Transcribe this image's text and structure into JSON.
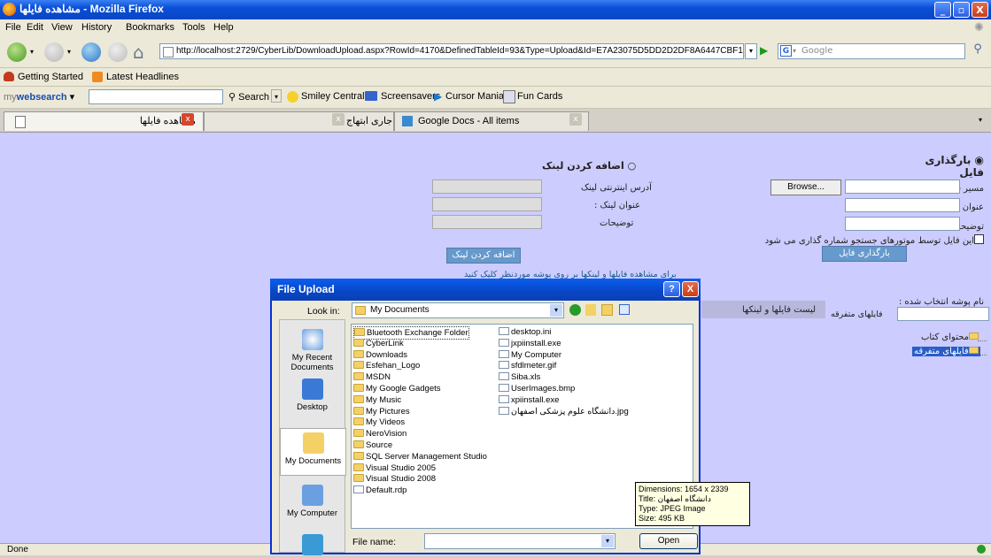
{
  "window": {
    "title": "مشاهده فایلها - Mozilla Firefox",
    "minimize": "_",
    "maximize": "▫",
    "close": "X"
  },
  "menu": [
    "File",
    "Edit",
    "View",
    "History",
    "Bookmarks",
    "Tools",
    "Help"
  ],
  "nav": {
    "url": "http://localhost:2729/CyberLib/DownloadUpload.aspx?RowId=4170&DefinedTableId=93&Type=Upload&Id=E7A23075D5DD2D2DF8A6447CBF18B8F3",
    "search_placeholder": "Google",
    "search_engine": "G"
  },
  "bookmarks": [
    "Getting Started",
    "Latest Headlines"
  ],
  "toolbar": {
    "brand_prefix": "my",
    "brand_main": "websearch",
    "search_button": "Search",
    "items": [
      "Smiley Central",
      "Screensavers",
      "Cursor Mania",
      "Fun Cards"
    ]
  },
  "tabs": [
    {
      "label": "مشاهده فایلها"
    },
    {
      "label": "Google Docs - فعالیت های جاری ابتهاج"
    },
    {
      "label": "Google Docs - All items"
    }
  ],
  "page": {
    "upload_radio": "بارگذاری فایل",
    "file_path_label": "مسیر فایل",
    "browse_button": "Browse...",
    "file_title_label": "عنوان فایل",
    "description_label": "توضیحات",
    "index_checkbox": "این فایل توسط موتورهای جستجو شماره گذاری می شود",
    "upload_button": "بارگذاری فایل",
    "add_link_radio": "اضافه کردن لینک",
    "link_address_label": "آدرس اینترنتی لینک",
    "link_title_label": "عنوان لینک :",
    "link_desc_label": "توضیحات",
    "add_link_button": "اضافه کردن لینک",
    "view_hint": "برای مشاهده فایلها و لینکها بر روی پوشه موردنظر کلیک کنید",
    "selected_folder_label": "نام پوشه انتخاب شده :",
    "selected_folder_value": "فایلهای متفرقه",
    "list_header": "لیست فایلها و لینکها",
    "tree_items": [
      "محتوای کتاب",
      "فایلهای متفرقه"
    ]
  },
  "dialog": {
    "title": "File Upload",
    "help": "?",
    "close": "X",
    "look_in_label": "Look in:",
    "look_in_value": "My Documents",
    "places": [
      "My Recent Documents",
      "Desktop",
      "My Documents",
      "My Computer",
      ""
    ],
    "files_col1": [
      {
        "name": "Bluetooth Exchange Folder",
        "type": "folder"
      },
      {
        "name": "CyberLink",
        "type": "folder"
      },
      {
        "name": "Downloads",
        "type": "folder"
      },
      {
        "name": "Esfehan_Logo",
        "type": "folder"
      },
      {
        "name": "MSDN",
        "type": "folder"
      },
      {
        "name": "My Google Gadgets",
        "type": "folder"
      },
      {
        "name": "My Music",
        "type": "folder"
      },
      {
        "name": "My Pictures",
        "type": "folder"
      },
      {
        "name": "My Videos",
        "type": "folder"
      },
      {
        "name": "NeroVision",
        "type": "folder"
      },
      {
        "name": "Source",
        "type": "folder"
      },
      {
        "name": "SQL Server Management Studio",
        "type": "folder"
      },
      {
        "name": "Visual Studio 2005",
        "type": "folder"
      },
      {
        "name": "Visual Studio 2008",
        "type": "folder"
      },
      {
        "name": "Default.rdp",
        "type": "file"
      }
    ],
    "files_col2": [
      {
        "name": "desktop.ini",
        "type": "file"
      },
      {
        "name": "jxpiinstall.exe",
        "type": "file"
      },
      {
        "name": "My Computer",
        "type": "file"
      },
      {
        "name": "sfdlmeter.gif",
        "type": "file"
      },
      {
        "name": "Siba.xls",
        "type": "file"
      },
      {
        "name": "UserImages.bmp",
        "type": "file"
      },
      {
        "name": "xpiinstall.exe",
        "type": "file"
      },
      {
        "name": "دانشگاه علوم پزشکی اصفهان.jpg",
        "type": "file"
      }
    ],
    "tooltip": [
      "Dimensions: 1654 x 2339",
      "Title: دانشگاه اصفهان",
      "Type: JPEG Image",
      "Size: 495 KB"
    ],
    "file_name_label": "File name:",
    "open_button": "Open"
  },
  "status": {
    "text": "Done"
  }
}
